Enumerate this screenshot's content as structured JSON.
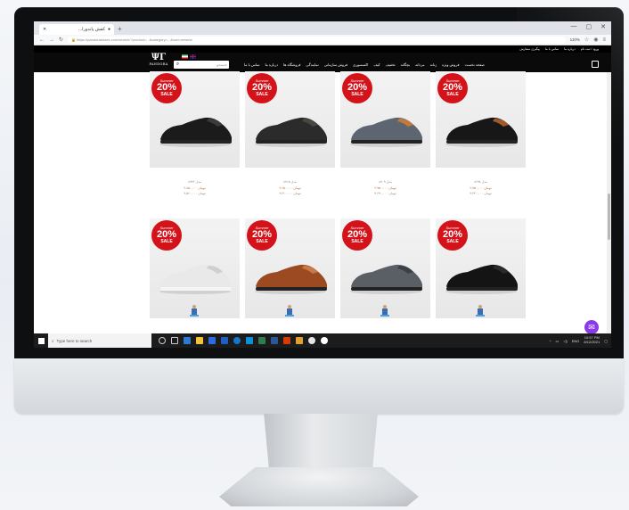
{
  "browser": {
    "tab_title": "...کفش پاندورا",
    "new_tab": "+",
    "url_host": "pandora",
    "url": "https://pandorashoes.com/search/?product=...&category=...&sort=newest",
    "zoom": "110%",
    "window_controls": [
      "—",
      "▢",
      "✕"
    ]
  },
  "site": {
    "top_links": [
      "پیگیری سفارش",
      "تماس با ما",
      "درباره ما",
      "ورود / ثبت نام"
    ],
    "logo_word": "PANDORA",
    "search_placeholder": "جستجو",
    "nav_links": [
      "صفحه نخست",
      "فروش ویژه",
      "زنانه",
      "مردانه",
      "بچگانه",
      "تخفیف",
      "کیف",
      "اکسسوری",
      "فروش سازمانی",
      "نمایندگی",
      "فروشگاه ها",
      "درباره ما",
      "تماس با ما"
    ]
  },
  "products": {
    "row1": [
      {
        "badge_small": "Summer",
        "badge_pct": "20%",
        "badge_sale": "SALE",
        "name": "مدل ۸۷۳۲",
        "price": "۲,۸۵۰,۰۰۰ تومان",
        "price2": "۳,۵۶۰,۰۰۰ تومان"
      },
      {
        "badge_small": "Summer",
        "badge_pct": "20%",
        "badge_sale": "SALE",
        "name": "مدل ۸۷۱۵",
        "price": "۲,۶۵۰,۰۰۰ تومان",
        "price2": "۳,۳۱۰,۰۰۰ تومان"
      },
      {
        "badge_small": "Summer",
        "badge_pct": "20%",
        "badge_sale": "SALE",
        "name": "مدل ۸۷۰۹",
        "price": "۲,۹۵۰,۰۰۰ تومان",
        "price2": "۳,۶۹۰,۰۰۰ تومان"
      },
      {
        "badge_small": "Summer",
        "badge_pct": "20%",
        "badge_sale": "SALE",
        "name": "مدل ۸۶۹۸",
        "price": "۲,۷۵۰,۰۰۰ تومان",
        "price2": "۳,۴۴۰,۰۰۰ تومان"
      }
    ],
    "row2": [
      {
        "badge_small": "Summer",
        "badge_pct": "20%",
        "badge_sale": "SALE"
      },
      {
        "badge_small": "Summer",
        "badge_pct": "20%",
        "badge_sale": "SALE"
      },
      {
        "badge_small": "Summer",
        "badge_pct": "20%",
        "badge_sale": "SALE"
      },
      {
        "badge_small": "Summer",
        "badge_pct": "20%",
        "badge_sale": "SALE"
      }
    ]
  },
  "taskbar": {
    "search_placeholder": "Type here to search",
    "lang": "ENG",
    "time": "10:57 PM",
    "date": "8/12/2021"
  },
  "colors": {
    "sale_badge": "#d4121a",
    "chat_bubble": "#8a3ae8",
    "header": "#0a0a0a"
  }
}
